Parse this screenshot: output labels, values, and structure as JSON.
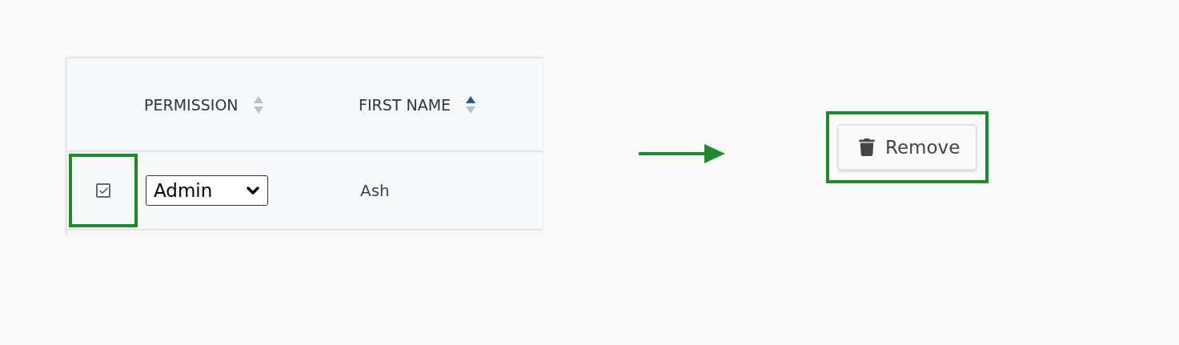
{
  "table": {
    "columns": [
      {
        "label": "PERMISSION",
        "sorted": false
      },
      {
        "label": "FIRST NAME",
        "sorted": true
      }
    ],
    "rows": [
      {
        "checked": true,
        "highlighted": true,
        "permission": "Admin",
        "first_name": "Ash"
      }
    ]
  },
  "action": {
    "label": "Remove",
    "highlighted": true
  }
}
